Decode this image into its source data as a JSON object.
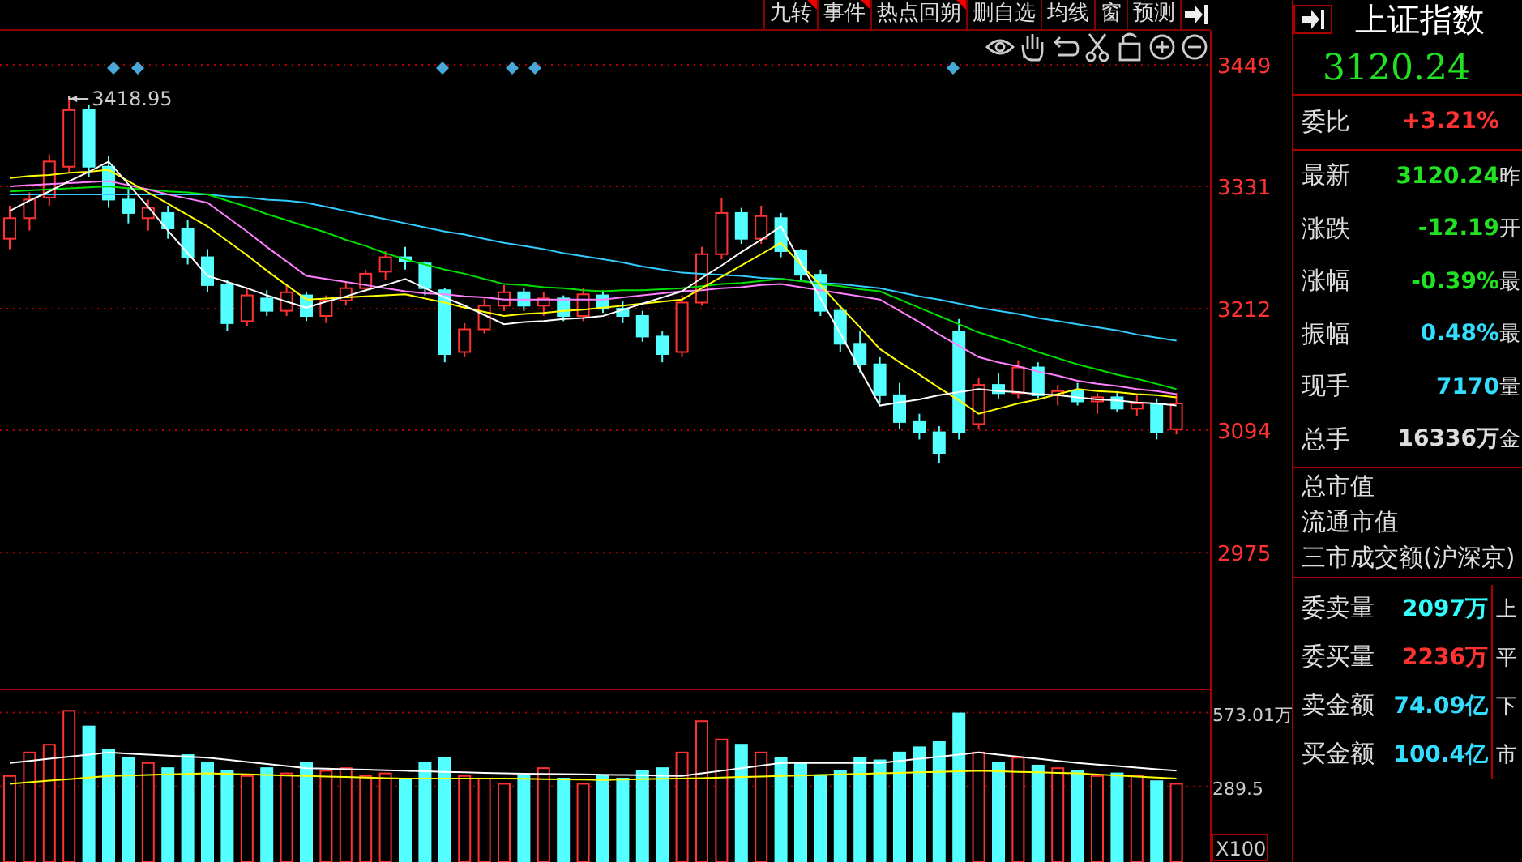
{
  "toolbar": {
    "buttons": [
      {
        "label": "九转",
        "flagged": true
      },
      {
        "label": "事件",
        "flagged": true
      },
      {
        "label": "热点回朔",
        "flagged": true
      },
      {
        "label": "删自选",
        "flagged": false
      },
      {
        "label": "均线",
        "flagged": false
      },
      {
        "label": "窗",
        "flagged": false
      },
      {
        "label": "预测",
        "flagged": false
      }
    ]
  },
  "chart": {
    "peak_label": "3418.95",
    "chart_data": {
      "type": "candlestick",
      "grid": true,
      "ylim": [
        2843,
        3482
      ],
      "yticks": [
        3449,
        3331,
        3212,
        3094,
        2975
      ],
      "ohlc": [
        [
          3280,
          3312,
          3270,
          3300
        ],
        [
          3300,
          3325,
          3288,
          3318
        ],
        [
          3320,
          3362,
          3312,
          3355
        ],
        [
          3350,
          3418.95,
          3345,
          3405
        ],
        [
          3405,
          3410,
          3340,
          3350
        ],
        [
          3350,
          3360,
          3310,
          3318
        ],
        [
          3318,
          3330,
          3295,
          3305
        ],
        [
          3300,
          3318,
          3288,
          3310
        ],
        [
          3305,
          3312,
          3280,
          3290
        ],
        [
          3290,
          3298,
          3255,
          3262
        ],
        [
          3262,
          3270,
          3228,
          3235
        ],
        [
          3235,
          3240,
          3190,
          3198
        ],
        [
          3200,
          3232,
          3195,
          3225
        ],
        [
          3222,
          3230,
          3205,
          3210
        ],
        [
          3210,
          3235,
          3205,
          3228
        ],
        [
          3225,
          3228,
          3200,
          3205
        ],
        [
          3205,
          3225,
          3198,
          3220
        ],
        [
          3220,
          3238,
          3215,
          3232
        ],
        [
          3232,
          3250,
          3228,
          3246
        ],
        [
          3248,
          3268,
          3240,
          3262
        ],
        [
          3262,
          3272,
          3250,
          3258
        ],
        [
          3256,
          3258,
          3225,
          3232
        ],
        [
          3230,
          3232,
          3160,
          3168
        ],
        [
          3170,
          3198,
          3165,
          3192
        ],
        [
          3192,
          3222,
          3188,
          3215
        ],
        [
          3215,
          3235,
          3210,
          3228
        ],
        [
          3228,
          3232,
          3210,
          3215
        ],
        [
          3215,
          3228,
          3205,
          3222
        ],
        [
          3222,
          3225,
          3200,
          3205
        ],
        [
          3205,
          3232,
          3200,
          3226
        ],
        [
          3225,
          3230,
          3208,
          3212
        ],
        [
          3212,
          3220,
          3198,
          3205
        ],
        [
          3205,
          3210,
          3180,
          3185
        ],
        [
          3185,
          3190,
          3160,
          3168
        ],
        [
          3170,
          3225,
          3165,
          3218
        ],
        [
          3218,
          3272,
          3215,
          3265
        ],
        [
          3265,
          3320,
          3260,
          3305
        ],
        [
          3305,
          3310,
          3275,
          3280
        ],
        [
          3280,
          3312,
          3275,
          3302
        ],
        [
          3300,
          3305,
          3262,
          3268
        ],
        [
          3268,
          3270,
          3240,
          3245
        ],
        [
          3245,
          3250,
          3205,
          3210
        ],
        [
          3210,
          3215,
          3170,
          3178
        ],
        [
          3178,
          3190,
          3150,
          3158
        ],
        [
          3158,
          3165,
          3120,
          3128
        ],
        [
          3128,
          3140,
          3095,
          3102
        ],
        [
          3102,
          3110,
          3085,
          3092
        ],
        [
          3092,
          3098,
          3062,
          3072
        ],
        [
          3190,
          3202,
          3085,
          3092
        ],
        [
          3100,
          3145,
          3095,
          3138
        ],
        [
          3138,
          3150,
          3125,
          3130
        ],
        [
          3130,
          3162,
          3125,
          3155
        ],
        [
          3155,
          3160,
          3125,
          3128
        ],
        [
          3128,
          3138,
          3118,
          3132
        ],
        [
          3132,
          3140,
          3118,
          3122
        ],
        [
          3122,
          3130,
          3110,
          3126
        ],
        [
          3126,
          3132,
          3112,
          3115
        ],
        [
          3115,
          3128,
          3108,
          3120
        ],
        [
          3120,
          3125,
          3085,
          3092
        ],
        [
          3095,
          3130,
          3090,
          3120
        ]
      ],
      "series": [
        {
          "type": "line",
          "color": "#33ccff",
          "values": [
            3323,
            3323,
            3323,
            3323,
            3323,
            3323,
            3323,
            3323,
            3323,
            3323,
            3323,
            3321,
            3320,
            3318,
            3317,
            3315,
            3311,
            3307,
            3303,
            3299,
            3295,
            3291,
            3287,
            3284,
            3280,
            3276,
            3273,
            3270,
            3266,
            3263,
            3260,
            3257,
            3253,
            3250,
            3247,
            3246,
            3245,
            3244,
            3242,
            3241,
            3239,
            3237,
            3236,
            3234,
            3232,
            3228,
            3224,
            3221,
            3217,
            3213,
            3210,
            3207,
            3203,
            3200,
            3197,
            3194,
            3191,
            3187,
            3184,
            3181
          ]
        },
        {
          "type": "line",
          "color": "#00e000",
          "values": [
            3326,
            3327,
            3328,
            3329,
            3330,
            3331,
            3329,
            3328,
            3326,
            3325,
            3323,
            3317,
            3311,
            3304,
            3298,
            3292,
            3286,
            3279,
            3273,
            3266,
            3260,
            3255,
            3250,
            3246,
            3241,
            3236,
            3235,
            3233,
            3232,
            3230,
            3229,
            3230,
            3230,
            3231,
            3232,
            3234,
            3236,
            3237,
            3239,
            3241,
            3239,
            3236,
            3234,
            3231,
            3229,
            3221,
            3213,
            3205,
            3197,
            3189,
            3183,
            3177,
            3170,
            3164,
            3158,
            3153,
            3148,
            3144,
            3139,
            3134
          ]
        },
        {
          "type": "line",
          "color": "#ff80ff",
          "values": [
            3331,
            3332,
            3333,
            3334,
            3335,
            3336,
            3332,
            3328,
            3323,
            3319,
            3315,
            3301,
            3287,
            3272,
            3258,
            3244,
            3241,
            3238,
            3235,
            3232,
            3229,
            3227,
            3226,
            3224,
            3223,
            3221,
            3221,
            3221,
            3221,
            3221,
            3221,
            3223,
            3225,
            3227,
            3229,
            3230,
            3232,
            3233,
            3235,
            3236,
            3233,
            3230,
            3227,
            3224,
            3221,
            3210,
            3199,
            3187,
            3176,
            3165,
            3160,
            3156,
            3151,
            3147,
            3142,
            3139,
            3137,
            3134,
            3132,
            3129
          ]
        },
        {
          "type": "line",
          "color": "#ffff00",
          "values": [
            3339,
            3341,
            3342,
            3344,
            3345,
            3347,
            3336,
            3325,
            3314,
            3303,
            3292,
            3278,
            3264,
            3249,
            3235,
            3221,
            3222,
            3223,
            3224,
            3225,
            3226,
            3222,
            3218,
            3213,
            3209,
            3205,
            3207,
            3208,
            3210,
            3211,
            3213,
            3215,
            3217,
            3219,
            3221,
            3232,
            3243,
            3254,
            3265,
            3276,
            3255,
            3235,
            3214,
            3194,
            3173,
            3160,
            3148,
            3135,
            3123,
            3110,
            3115,
            3120,
            3124,
            3129,
            3134,
            3132,
            3131,
            3129,
            3128,
            3126
          ]
        },
        {
          "type": "line",
          "color": "#ffffff",
          "values": [
            3307,
            3317,
            3326,
            3336,
            3345,
            3355,
            3333,
            3311,
            3288,
            3266,
            3244,
            3238,
            3232,
            3225,
            3219,
            3213,
            3219,
            3224,
            3230,
            3235,
            3241,
            3232,
            3223,
            3215,
            3206,
            3197,
            3199,
            3200,
            3202,
            3203,
            3205,
            3211,
            3217,
            3223,
            3229,
            3242,
            3254,
            3267,
            3279,
            3292,
            3257,
            3222,
            3188,
            3153,
            3118,
            3121,
            3124,
            3128,
            3131,
            3134,
            3132,
            3131,
            3129,
            3128,
            3126,
            3124,
            3123,
            3121,
            3120,
            3118
          ]
        }
      ]
    }
  },
  "volume": {
    "scale": "X100",
    "chart_data": {
      "type": "bar",
      "grid": true,
      "ylim": [
        0,
        665
      ],
      "yticks": [
        {
          "value": 573.01,
          "label": "573.01万"
        },
        {
          "value": 289.5,
          "label": "289.5"
        }
      ],
      "colors": [
        "#ff3232",
        "#ff3232",
        "#ff3232",
        "#ff3232",
        "#54ffff",
        "#54ffff",
        "#54ffff",
        "#ff3232",
        "#54ffff",
        "#54ffff",
        "#54ffff",
        "#54ffff",
        "#ff3232",
        "#54ffff",
        "#ff3232",
        "#54ffff",
        "#ff3232",
        "#ff3232",
        "#ff3232",
        "#ff3232",
        "#54ffff",
        "#54ffff",
        "#54ffff",
        "#ff3232",
        "#ff3232",
        "#ff3232",
        "#54ffff",
        "#ff3232",
        "#54ffff",
        "#ff3232",
        "#54ffff",
        "#54ffff",
        "#54ffff",
        "#54ffff",
        "#ff3232",
        "#ff3232",
        "#ff3232",
        "#54ffff",
        "#ff3232",
        "#54ffff",
        "#54ffff",
        "#54ffff",
        "#54ffff",
        "#54ffff",
        "#54ffff",
        "#54ffff",
        "#54ffff",
        "#54ffff",
        "#54ffff",
        "#ff3232",
        "#54ffff",
        "#ff3232",
        "#54ffff",
        "#ff3232",
        "#54ffff",
        "#ff3232",
        "#54ffff",
        "#ff3232",
        "#54ffff",
        "#ff3232"
      ],
      "values": [
        330,
        420,
        450,
        580,
        520,
        430,
        400,
        380,
        360,
        410,
        380,
        350,
        330,
        360,
        340,
        380,
        350,
        360,
        330,
        340,
        320,
        380,
        400,
        330,
        320,
        300,
        330,
        360,
        320,
        300,
        330,
        320,
        350,
        360,
        420,
        540,
        470,
        450,
        420,
        400,
        380,
        330,
        350,
        400,
        390,
        420,
        440,
        460,
        570,
        420,
        380,
        400,
        370,
        360,
        350,
        330,
        340,
        330,
        310,
        300
      ],
      "series": [
        {
          "type": "line",
          "color": "#ffffff",
          "values": [
            380,
            388,
            396,
            404,
            412,
            420,
            416,
            412,
            408,
            404,
            400,
            392,
            384,
            376,
            368,
            360,
            358,
            356,
            354,
            352,
            350,
            348,
            346,
            344,
            342,
            340,
            339,
            338,
            337,
            336,
            335,
            334,
            333,
            331,
            330,
            340,
            350,
            360,
            370,
            380,
            380,
            380,
            380,
            380,
            380,
            388,
            396,
            404,
            412,
            420,
            412,
            404,
            396,
            388,
            380,
            374,
            368,
            362,
            356,
            350
          ]
        },
        {
          "type": "line",
          "color": "#ffff00",
          "values": [
            300,
            306,
            312,
            318,
            324,
            330,
            332,
            334,
            336,
            338,
            340,
            338,
            336,
            334,
            332,
            330,
            328,
            326,
            324,
            322,
            320,
            320,
            320,
            320,
            320,
            320,
            319,
            318,
            317,
            316,
            315,
            316,
            318,
            319,
            320,
            322,
            324,
            326,
            328,
            330,
            332,
            334,
            336,
            338,
            340,
            342,
            344,
            346,
            348,
            350,
            348,
            346,
            344,
            342,
            340,
            336,
            332,
            328,
            324,
            320
          ]
        }
      ]
    }
  },
  "quote": {
    "title": "上证指数",
    "price": "3120.24",
    "ratio": {
      "label": "委比",
      "value": "+3.21%",
      "color": "#ff3232"
    },
    "stats": [
      {
        "label": "最新",
        "value": "3120.24",
        "color": "#22e022",
        "side": "昨"
      },
      {
        "label": "涨跌",
        "value": "-12.19",
        "color": "#22e022",
        "side": "开"
      },
      {
        "label": "涨幅",
        "value": "-0.39%",
        "color": "#22e022",
        "side": "最"
      },
      {
        "label": "振幅",
        "value": "0.48%",
        "color": "#33ddff",
        "side": "最"
      },
      {
        "label": "现手",
        "value": "7170",
        "color": "#33ddff",
        "side": "量"
      },
      {
        "label": "总手",
        "value": "16336万",
        "color": "#dddddd",
        "side": "金"
      }
    ],
    "market": [
      "总市值",
      "流通市值",
      "三市成交额(沪深京)"
    ],
    "orders": [
      {
        "label": "委卖量",
        "value": "2097万",
        "color": "#33ffff",
        "side": "上"
      },
      {
        "label": "委买量",
        "value": "2236万",
        "color": "#ff3232",
        "side": "平"
      },
      {
        "label": "卖金额",
        "value": "74.09亿",
        "color": "#33ddff",
        "side": "下"
      },
      {
        "label": "买金额",
        "value": "100.4亿",
        "color": "#33ddff",
        "side": "市"
      }
    ]
  }
}
